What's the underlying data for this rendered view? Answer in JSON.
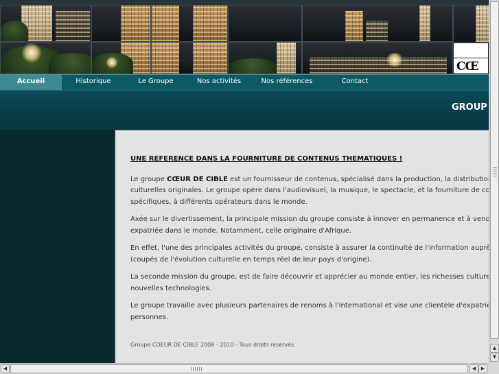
{
  "banner": {
    "logo_text": "CŒ"
  },
  "nav": {
    "items": [
      {
        "label": "Accueil"
      },
      {
        "label": "Historique"
      },
      {
        "label": "Le Groupe"
      },
      {
        "label": "Nos activités"
      },
      {
        "label": "Nos références"
      },
      {
        "label": "Contact"
      }
    ]
  },
  "subheader": {
    "title": "GROUP"
  },
  "content": {
    "headline": "UNE REFERENCE DANS LA FOURNITURE DE CONTENUS THEMATIQUES !",
    "p1_before": "Le groupe ",
    "p1_bold": "CŒUR DE CIBLE",
    "p1_after": " est un fournisseur de contenus, spécialisé dans la production, la distribution e\nculturelles originales. Le groupe opère dans l'audiovisuel, la musique, le spectacle, et la fourniture de cont\nspécifiques, à différents opérateurs dans le monde.",
    "p2": " Axée sur le divertissement, la principale mission du groupe consiste à innover en permanence et à vendre\nexpatriée dans le monde. Notamment, celle originaire d'Afrique.",
    "p3": "En effet, l'une des principales activités du groupe, consiste à assurer la continuité de l'information auprès d\n(coupés de l'évolution culturelle en temps réel de leur pays d'origine).",
    "p4": "La seconde mission du groupe, est de faire découvrir et apprécier au monde entier, les richesses culturelle\nnouvelles technologies.",
    "p5": "Le groupe travaille avec plusieurs partenaires de renoms à l'international et vise une clientèle d'expatriée\npersonnes.",
    "footer": "Groupe COEUR DE CIBLE 2008 - 2010 - Tous droits reservés"
  },
  "colors": {
    "nav_bg": "#0d5a66",
    "nav_active": "#3e8994",
    "sidebar": "#0b2a2f",
    "content_bg": "#e3e3e3"
  }
}
